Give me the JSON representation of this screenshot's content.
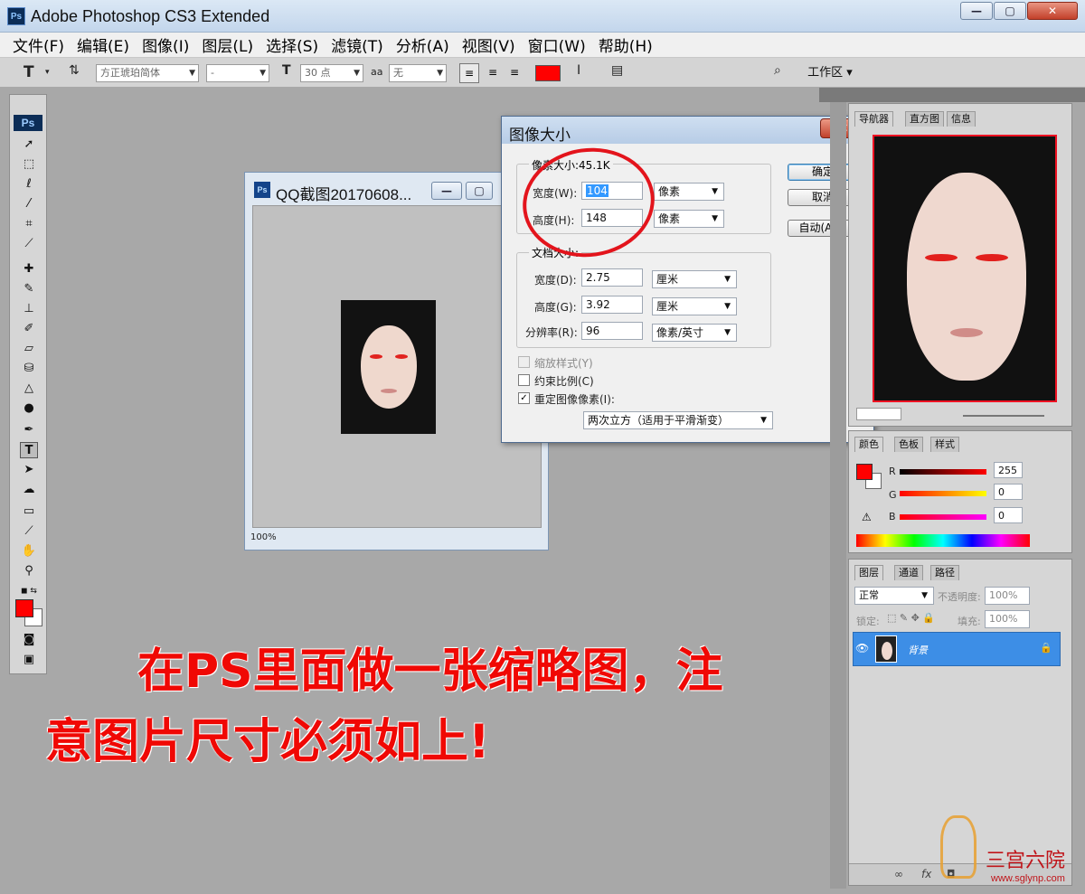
{
  "app": {
    "title": "Adobe Photoshop CS3 Extended",
    "logo": "Ps"
  },
  "window_buttons": {
    "minimize": "—",
    "maximize": "▢",
    "close": "✕"
  },
  "menu": [
    "文件(F)",
    "编辑(E)",
    "图像(I)",
    "图层(L)",
    "选择(S)",
    "滤镜(T)",
    "分析(A)",
    "视图(V)",
    "窗口(W)",
    "帮助(H)"
  ],
  "options_bar": {
    "tool_glyph": "T",
    "font_family": "方正琥珀简体",
    "font_style": "-",
    "font_size": "30 点",
    "anti_alias": "无",
    "text_color": "#ff0000",
    "workspace_label": "工作区 ▾"
  },
  "document": {
    "title": "QQ截图20170608...",
    "zoom": "100%",
    "icon": "Ps"
  },
  "dialog": {
    "title": "图像大小",
    "pixel_group_title": "像素大小:45.1K",
    "width_label": "宽度(W):",
    "width_value": "104",
    "width_unit": "像素",
    "height_label": "高度(H):",
    "height_value": "148",
    "height_unit": "像素",
    "doc_group_title": "文档大小:",
    "doc_width_label": "宽度(D):",
    "doc_width_value": "2.75",
    "doc_width_unit": "厘米",
    "doc_height_label": "高度(G):",
    "doc_height_value": "3.92",
    "doc_height_unit": "厘米",
    "resolution_label": "分辨率(R):",
    "resolution_value": "96",
    "resolution_unit": "像素/英寸",
    "scale_styles": "缩放样式(Y)",
    "constrain": "约束比例(C)",
    "resample": "重定图像像素(I):",
    "resample_checked": true,
    "resample_method": "两次立方（适用于平滑渐变）",
    "ok": "确定",
    "cancel": "取消",
    "auto": "自动(A)..."
  },
  "navigator_panel": {
    "tabs": [
      "导航器",
      "直方图",
      "信息"
    ]
  },
  "color_panel": {
    "tabs": [
      "颜色",
      "色板",
      "样式"
    ],
    "r_label": "R",
    "r_value": "255",
    "g_label": "G",
    "g_value": "0",
    "b_label": "B",
    "b_value": "0",
    "foreground": "#ff0000"
  },
  "layers_panel": {
    "tabs": [
      "图层",
      "通道",
      "路径"
    ],
    "blend_mode": "正常",
    "opacity_label": "不透明度:",
    "opacity_value": "100%",
    "lock_label": "锁定:",
    "fill_label": "填充:",
    "fill_value": "100%",
    "layer_name": "背景"
  },
  "annotation": {
    "line1": "在PS里面做一张缩略图，注",
    "line2": "意图片尺寸必须如上!",
    "color": "#ff0000"
  },
  "watermark": {
    "name": "三宫六院",
    "url": "www.sglynp.com"
  }
}
